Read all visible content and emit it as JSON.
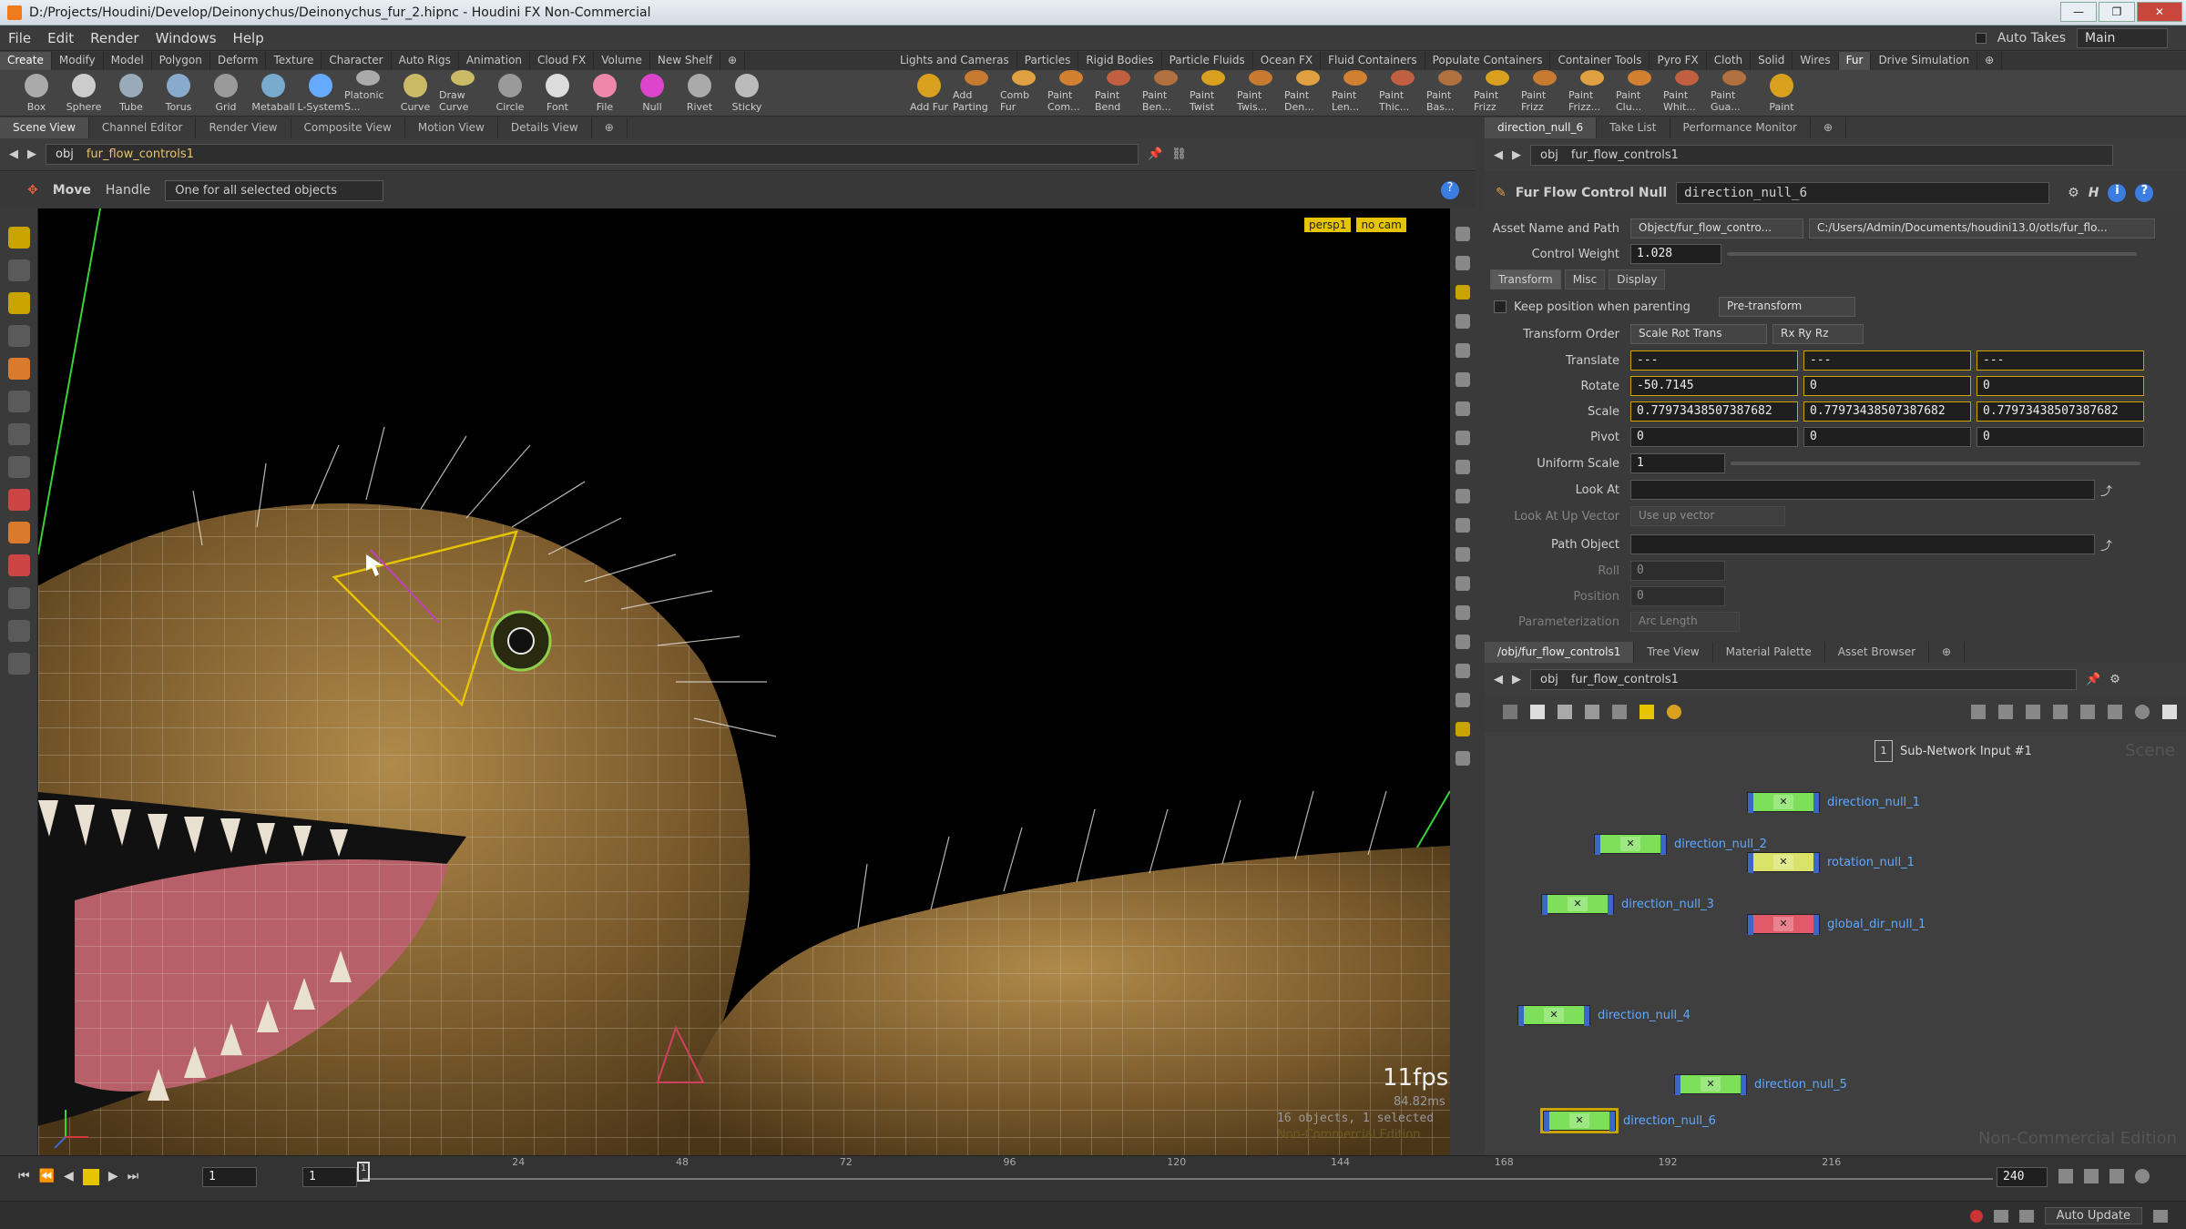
{
  "window": {
    "title": "D:/Projects/Houdini/Develop/Deinonychus/Deinonychus_fur_2.hipnc - Houdini FX Non-Commercial"
  },
  "menu": {
    "items": [
      "File",
      "Edit",
      "Render",
      "Windows",
      "Help"
    ],
    "auto_takes": "Auto Takes",
    "desktop": "Main"
  },
  "shelf_tabs_left": [
    "Create",
    "Modify",
    "Model",
    "Polygon",
    "Deform",
    "Texture",
    "Character",
    "Auto Rigs",
    "Animation",
    "Cloud FX",
    "Volume",
    "New Shelf"
  ],
  "shelf_tabs_right": [
    "Lights and Cameras",
    "Particles",
    "Rigid Bodies",
    "Particle Fluids",
    "Ocean FX",
    "Fluid Containers",
    "Populate Containers",
    "Container Tools",
    "Pyro FX",
    "Cloth",
    "Solid",
    "Wires",
    "Fur",
    "Drive Simulation"
  ],
  "tools_left": [
    "Box",
    "Sphere",
    "Tube",
    "Torus",
    "Grid",
    "Metaball",
    "L-System",
    "Platonic S...",
    "Curve",
    "Draw Curve",
    "Circle",
    "Font",
    "File",
    "Null",
    "Rivet",
    "Sticky"
  ],
  "tools_right": [
    "Add Fur",
    "Add Parting",
    "Comb Fur",
    "Paint Com...",
    "Paint Bend",
    "Paint Ben...",
    "Paint Twist",
    "Paint Twis...",
    "Paint Den...",
    "Paint Len...",
    "Paint Thic...",
    "Paint Bas...",
    "Paint Frizz",
    "Paint Frizz",
    "Paint Frizz...",
    "Paint Clu...",
    "Paint Whit...",
    "Paint Gua...",
    "Paint"
  ],
  "viewer": {
    "tabs": [
      "Scene View",
      "Channel Editor",
      "Render View",
      "Composite View",
      "Motion View",
      "Details View"
    ],
    "path_root": "obj",
    "path_node": "fur_flow_controls1",
    "tool_name": "Move",
    "tool_mode": "Handle",
    "selection_mode": "One for all selected objects",
    "camera": "persp1",
    "cam_lock": "no cam",
    "fps": "11fps",
    "ms": "84.82ms",
    "object_count": "16 objects, 1 selected",
    "edition": "Non-Commercial Edition"
  },
  "params": {
    "tabs": [
      "direction_null_6",
      "Take List",
      "Performance Monitor"
    ],
    "path_root": "obj",
    "path_node": "fur_flow_controls1",
    "node_type": "Fur Flow Control Null",
    "node_name": "direction_null_6",
    "asset_label": "Asset Name and Path",
    "asset_name": "Object/fur_flow_contro...",
    "asset_path": "C:/Users/Admin/Documents/houdini13.0/otls/fur_flo...",
    "control_weight_label": "Control Weight",
    "control_weight": "1.028",
    "subtabs": [
      "Transform",
      "Misc",
      "Display"
    ],
    "keep_pos_label": "Keep position when parenting",
    "pre_transform": "Pre-transform",
    "transform_order_label": "Transform Order",
    "transform_order": "Scale Rot Trans",
    "rot_order": "Rx Ry Rz",
    "translate_label": "Translate",
    "translate": [
      "---",
      "---",
      "---"
    ],
    "rotate_label": "Rotate",
    "rotate": [
      "-50.7145",
      "0",
      "0"
    ],
    "scale_label": "Scale",
    "scale": [
      "0.77973438507387682",
      "0.77973438507387682",
      "0.77973438507387682"
    ],
    "pivot_label": "Pivot",
    "pivot": [
      "0",
      "0",
      "0"
    ],
    "uniform_scale_label": "Uniform Scale",
    "uniform_scale": "1",
    "look_at_label": "Look At",
    "look_at_up_label": "Look At Up Vector",
    "look_at_up": "Use up vector",
    "path_object_label": "Path Object",
    "roll_label": "Roll",
    "roll": "0",
    "position_label": "Position",
    "position": "0",
    "param_label": "Parameterization",
    "param_value": "Arc Length"
  },
  "network": {
    "tabs": [
      "/obj/fur_flow_controls1",
      "Tree View",
      "Material Palette",
      "Asset Browser"
    ],
    "path_root": "obj",
    "path_node": "fur_flow_controls1",
    "subnet_label": "Sub-Network Input #1",
    "subnet_num": "1",
    "context_label": "Scene",
    "watermark": "Non-Commercial Edition",
    "nodes": [
      {
        "name": "direction_null_1",
        "color": "#7ee05a"
      },
      {
        "name": "direction_null_2",
        "color": "#7ee05a"
      },
      {
        "name": "rotation_null_1",
        "color": "#d9e36a"
      },
      {
        "name": "direction_null_3",
        "color": "#7ee05a"
      },
      {
        "name": "global_dir_null_1",
        "color": "#e05a6a"
      },
      {
        "name": "direction_null_4",
        "color": "#7ee05a"
      },
      {
        "name": "direction_null_5",
        "color": "#7ee05a"
      },
      {
        "name": "direction_null_6",
        "color": "#7ee05a"
      }
    ]
  },
  "timeline": {
    "start": "1",
    "current": "1",
    "end": "240",
    "ticks": [
      "24",
      "48",
      "72",
      "96",
      "120",
      "144",
      "168",
      "192",
      "216"
    ],
    "auto_update": "Auto Update"
  },
  "colors": {
    "accent": "#f07a1c",
    "selected_node": "#c9a400"
  }
}
